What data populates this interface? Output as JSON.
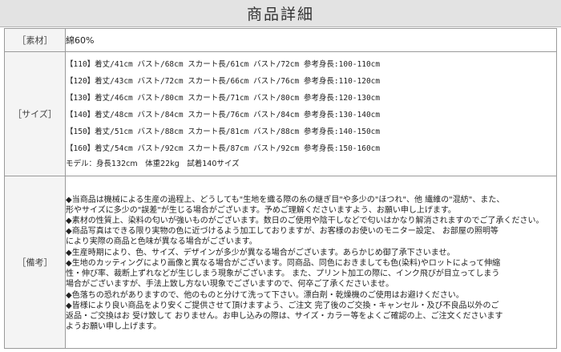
{
  "header": {
    "title": "商品詳細"
  },
  "material": {
    "label": "［素材］",
    "value": "綿60%"
  },
  "size": {
    "label": "［サイズ］",
    "rows": [
      "【110】着丈/41cm バスト/68cm スカート長/61cm バスト/72cm 参考身長:100-110cm",
      "【120】着丈/43cm バスト/72cm スカート長/66cm バスト/76cm 参考身長:110-120cm",
      "【130】着丈/46cm バスト/80cm スカート長/71cm バスト/80cm 参考身長:120-130cm",
      "【140】着丈/48cm バスト/84cm スカート長/76cm バスト/84cm 参考身長:130-140cm",
      "【150】着丈/51cm バスト/88cm スカート長/81cm バスト/88cm 参考身長:140-150cm",
      "【160】着丈/54cm バスト/92cm スカート長/87cm バスト/92cm 参考身長:150-160cm"
    ],
    "model": "モデル：身長132cm　体重22kg　試着140サイズ"
  },
  "notes": {
    "label": "［備考］",
    "lines": [
      "◆当商品は機械による生産の過程上、どうしても\"生地を織る際の糸の継ぎ目\"や多少の\"ほつれ\"、他 繊維の\"混紡\"、また、",
      "形やサイズに多少の\"誤差\"が生じる場合がございます。予めご理解くださいますよう、お願い申し上げます。",
      "◆素材の性質上、染料の匂いが強いものがございます。数日のご使用や陰干しなどで匂いはかなり解消されますのでご了承ください。",
      "◆商品写真はできる限り実物の色に近づけるよう加工しておりますが、お客様のお使いのモニター設定、 お部屋の照明等",
      "により実際の商品と色味が異なる場合がございます。",
      "◆生産時期により、色、サイズ、デザインが多少が異なる場合がございます。あらかじめ御了承下さいませ。",
      "◆生地のカッティングにより画像と異なる場合がございます。同商品、同色におきましても色(染料)やロットによって伸縮",
      "性・伸び率、裁断上ずれなどが生じしまう現象がございます。 また、プリント加工の際に、インク飛びが目立ってしまう",
      "場合がございますが、手法上致し方ない現象でございますので、何卒ご了承くださいませ。",
      "◆色落ちの恐れがありますので、他のものと分けて洗って下さい。漂白剤・乾燥機のご使用はお避けください。",
      "◆皆様により良い商品をより安くご提供させて頂けますよう、ご注文 完了後のご交換・キャンセル・及び不良品以外のご",
      "返品・ご交換はお 受け致して おりません。お申し込みの際は、サイズ・カラー等をよくご確認の上、ご注文くださいます",
      "ようお願い申し上げます。"
    ]
  }
}
